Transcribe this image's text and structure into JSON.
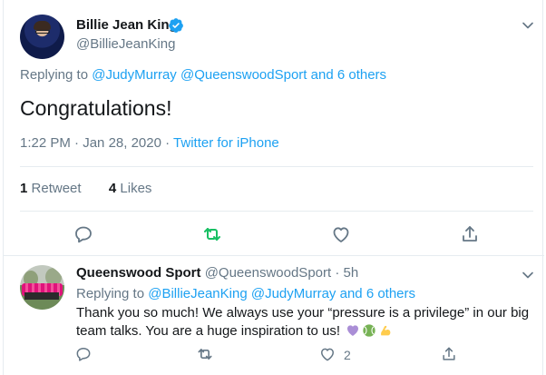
{
  "main_tweet": {
    "author_name": "Billie Jean King",
    "author_handle": "@BillieJeanKing",
    "replying_prefix": "Replying to ",
    "replying_mentions": [
      "@JudyMurray",
      "@QueenswoodSport"
    ],
    "replying_and": "and",
    "replying_others": "6 others",
    "text": "Congratulations!",
    "time": "1:22 PM",
    "date": "Jan 28, 2020",
    "source": "Twitter for iPhone",
    "retweet_count": "1",
    "retweet_label": "Retweet",
    "like_count": "4",
    "like_label": "Likes"
  },
  "reply_tweet": {
    "author_name": "Queenswood Sport",
    "author_handle": "@QueenswoodSport",
    "age": "5h",
    "replying_prefix": "Replying to ",
    "replying_mentions": [
      "@BillieJeanKing",
      "@JudyMurray"
    ],
    "replying_and": "and",
    "replying_others": "6 others",
    "text": "Thank you so much! We always use your “pressure is a privilege” in our big team talks. You are a huge inspiration to us!",
    "like_count": "2"
  },
  "icons": {
    "verified": "verified-badge-icon",
    "more": "chevron-down-icon",
    "reply": "reply-icon",
    "retweet": "retweet-icon",
    "like": "heart-icon",
    "share": "share-icon",
    "emoji": [
      "purple-heart-emoji",
      "tennis-ball-emoji",
      "flexed-biceps-emoji"
    ]
  },
  "colors": {
    "link": "#1da1f2",
    "secondary_text": "#657786",
    "primary_text": "#14171a",
    "retweet_active": "#17bf63",
    "divider": "#e6ecf0"
  }
}
